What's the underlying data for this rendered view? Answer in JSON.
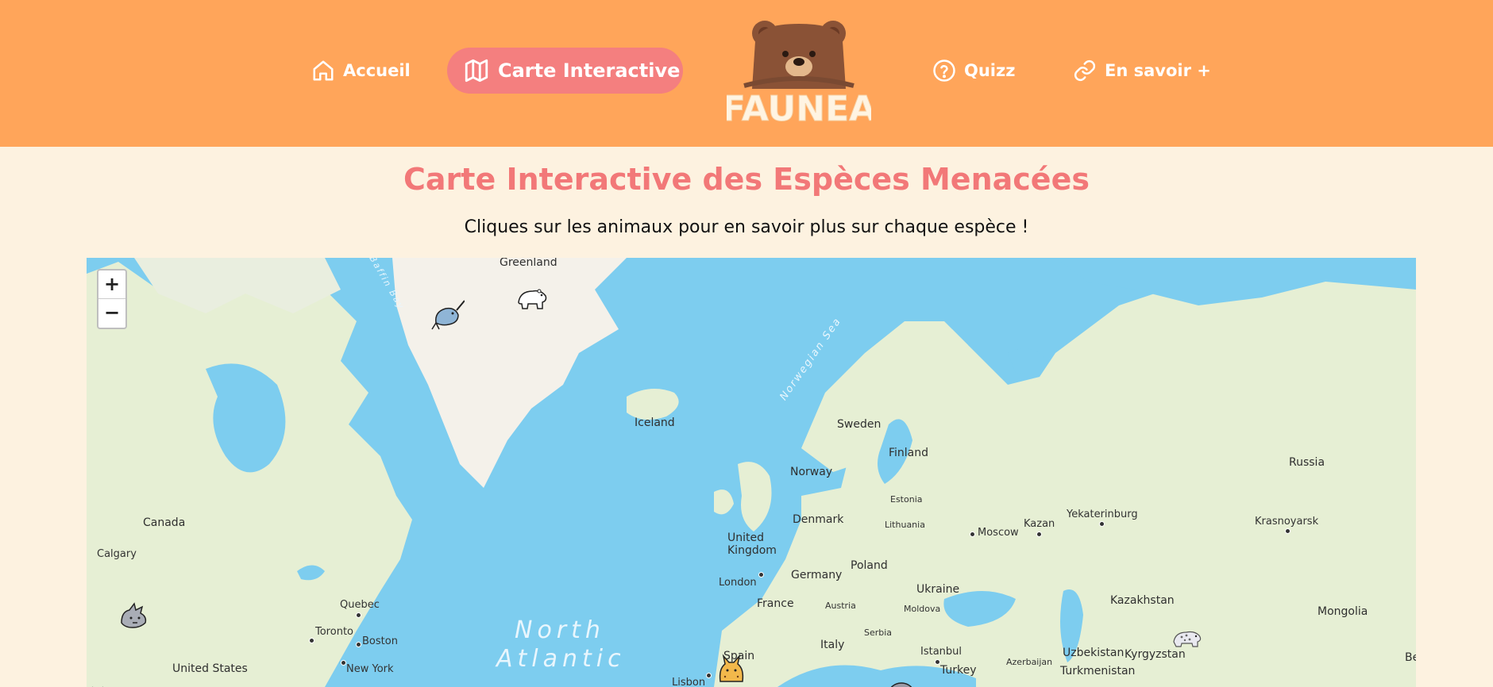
{
  "nav": {
    "home": {
      "label": "Accueil",
      "icon": "home-icon"
    },
    "map": {
      "label": "Carte Interactive",
      "icon": "map-icon"
    },
    "quiz": {
      "label": "Quizz",
      "icon": "help-circle-icon"
    },
    "more": {
      "label": "En savoir +",
      "icon": "link-icon"
    }
  },
  "logo": {
    "text": "FAUNEA",
    "icon": "bear-icon"
  },
  "page": {
    "title": "Carte Interactive des Espèces Menacées",
    "subtitle": "Cliques sur les animaux pour en savoir plus sur chaque espèce !"
  },
  "map": {
    "zoom_in": "+",
    "zoom_out": "−",
    "labels": {
      "greenland": "Greenland",
      "baffin_bay": "Baffin Bay",
      "norwegian_sea": "Norwegian Sea",
      "iceland": "Iceland",
      "sweden": "Sweden",
      "finland": "Finland",
      "norway": "Norway",
      "russia": "Russia",
      "estonia": "Estonia",
      "canada": "Canada",
      "united_kingdom": "United Kingdom",
      "denmark": "Denmark",
      "lithuania": "Lithuania",
      "moscow": "Moscow",
      "kazan": "Kazan",
      "yekaterinburg": "Yekaterinburg",
      "krasnoyarsk": "Krasnoyarsk",
      "calgary": "Calgary",
      "london": "London",
      "germany": "Germany",
      "poland": "Poland",
      "ukraine": "Ukraine",
      "france": "France",
      "austria": "Austria",
      "moldova": "Moldova",
      "kazakhstan": "Kazakhstan",
      "mongolia": "Mongolia",
      "quebec": "Quebec",
      "toronto": "Toronto",
      "boston": "Boston",
      "serbia": "Serbia",
      "north_atlantic_1": "North",
      "north_atlantic_2": "Atlantic",
      "italy": "Italy",
      "istanbul": "Istanbul",
      "uzbekistan": "Uzbekistan",
      "kyrgyzstan": "Kyrgyzstan",
      "azerbaijan": "Azerbaijan",
      "united_states": "United States",
      "new_york": "New York",
      "spain": "Spain",
      "lisbon": "Lisbon",
      "turkey": "Turkey",
      "turkmenistan": "Turkmenistan",
      "beijing_partial": "Bei"
    },
    "markers": [
      {
        "name": "narwhal-marker",
        "species_icon": "narwhal-icon"
      },
      {
        "name": "polar-bear-marker",
        "species_icon": "polar-bear-icon"
      },
      {
        "name": "wolf-marker",
        "species_icon": "wolf-icon"
      },
      {
        "name": "lynx-marker",
        "species_icon": "lynx-icon"
      },
      {
        "name": "snow-leopard-marker",
        "species_icon": "snow-leopard-icon"
      }
    ]
  },
  "colors": {
    "header": "#ffa55a",
    "accent": "#f47f7f",
    "background": "#fdf2e0",
    "sea": "#7dcdef",
    "land": "#e6efd4",
    "ice": "#f4f1ea"
  }
}
